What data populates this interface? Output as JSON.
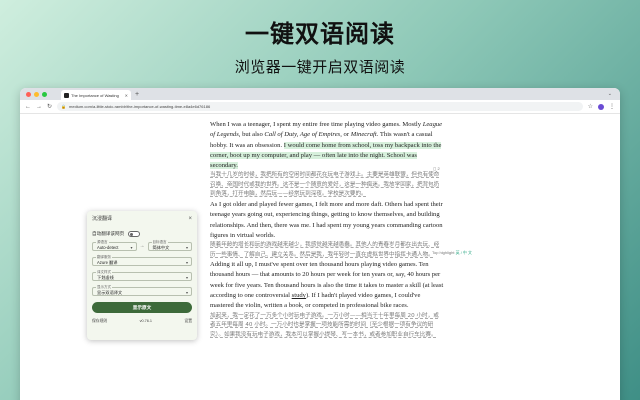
{
  "hero": {
    "title": "一键双语阅读",
    "subtitle": "浏览器一键开启双语阅读"
  },
  "browser": {
    "tab_title": "The Importance of Wasting",
    "url": "medium.com/a-little-stoic-ramblr/the-importance-of-wasting-time-e8a4e6d76186",
    "colors": {
      "close": "#ff5f57",
      "minimize": "#febc2e",
      "maximize": "#28c840"
    }
  },
  "article": {
    "p1": {
      "text_a": "When I was a teenager, I spent my entire free time playing video games. Mostly ",
      "em1": "League of Legends",
      "text_b": ", but also ",
      "em2": "Call of Duty, Age of Empires",
      "text_c": ", or ",
      "em3": "Minecraft",
      "text_d": ". This wasn't a casual hobby. It was an obsession. ",
      "highlight": "I would come home from school, toss my backpack into the corner, boot up my computer, and play — often late into the night. School was secondary.",
      "translation": "当我十几岁的时候，我把所有的空闲时间都花在玩电子游戏上。主要是英雄联盟，但也有使命召唤、帝国时代或我的世界。这不是一个随意的爱好，这是一种痴迷。我放学回家，把背包扔到角落，打开电脑，然后玩——经常玩到深夜。学校是次要的。"
    },
    "p2": {
      "text": "As I got older and played fewer games, I felt more and more daft. Others had spent their teenage years going out, experiencing things, getting to know themselves, and building relationships. And then, there was me. I had spent my young years commanding cartoon figures in virtual worlds.",
      "translation": "随着年龄的增长和玩的游戏越来越少，我感觉越来越愚蠢。其他人的青春岁月都在出去玩、经历一些事情、了解自己、建立关系。然后是我，我年轻时一直在虚拟世界中指挥卡通人物。"
    },
    "p3": {
      "text_a": "Adding it all up, I must've spent over ten thousand hours playing video games. Ten thousand hours — that amounts to 20 hours per week for ten years or, say, 40 hours per week for five years. Ten thousand hours is also the time it takes to master a skill (at least according to one controversial ",
      "link": "study",
      "text_b": "). If I hadn't played video games, I could've mastered the violin, written a book, or competed in professional bike races.",
      "translation": "加起来，我一定花了一万多个小时玩电子游戏。一万小时——相当于十年里每周 20 小时，或者五年里每周 40 小时。一万小时也是掌握一项技能所需的时间（至少根据一项有争议的研究）。如果我没有玩电子游戏，我本可以掌握小提琴、写一本书，或者参加职业自行车比赛。"
    },
    "side_count": "2",
    "side_note_prefix": "Top highlight",
    "side_note_mark": "英 / 中 文"
  },
  "panel": {
    "title": "沉浸翻译",
    "auto_label": "自动翻译该网页",
    "source_label": "源语言",
    "source_value": "Auto-detect",
    "target_label": "目标语言",
    "target_value": "简体中文",
    "service_label": "翻译服务",
    "service_value": "Azure 翻译",
    "mode_label": "译文样式",
    "mode_value": "下划虚线",
    "display_label": "显示方式",
    "display_value": "显示双语译文",
    "primary_button": "显示原文",
    "foot_left": "保存规则",
    "foot_mid": "v0.76.1",
    "foot_right": "设置"
  }
}
